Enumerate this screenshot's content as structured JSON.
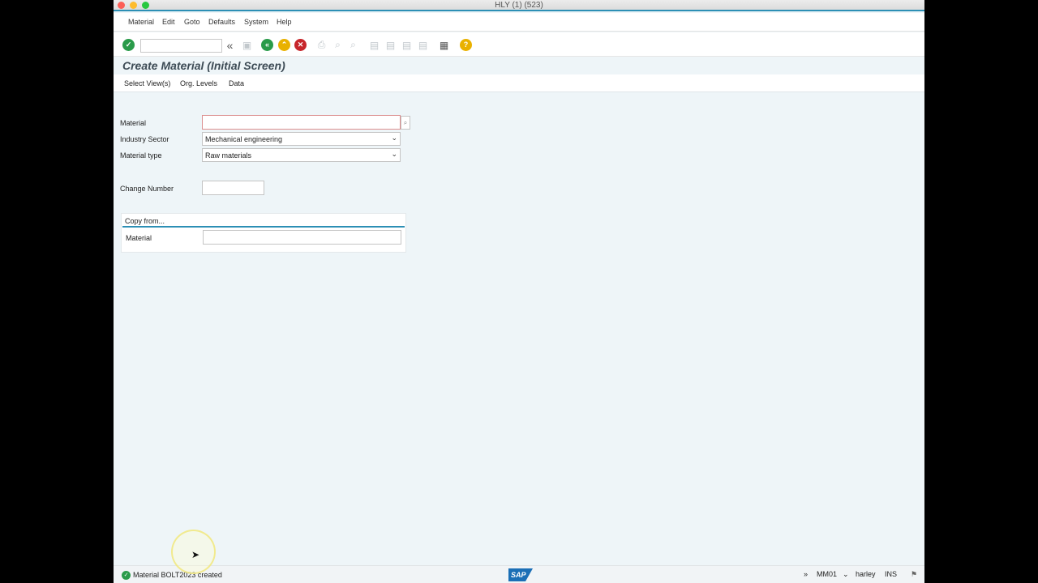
{
  "window": {
    "title": "HLY (1) (523)"
  },
  "menu": [
    "Material",
    "Edit",
    "Goto",
    "Defaults",
    "System",
    "Help"
  ],
  "toolbar": {
    "enter_icon": "check-circle-icon",
    "command_field_value": "",
    "back_icon": "chevron-double-left-icon",
    "exit_icon": "up-arrows-icon",
    "cancel_icon": "x-circle-icon",
    "help_icon": "question-icon",
    "help_symbol": "?",
    "collapse_symbol": "«"
  },
  "header": {
    "title": "Create Material (Initial Screen)"
  },
  "app_toolbar": [
    "Select View(s)",
    "Org. Levels",
    "Data"
  ],
  "form": {
    "material_label": "Material",
    "material_value": "",
    "industry_label": "Industry Sector",
    "industry_value": "Mechanical engineering",
    "type_label": "Material type",
    "type_value": "Raw materials",
    "change_label": "Change Number",
    "change_value": ""
  },
  "copy_from": {
    "title": "Copy from...",
    "material_label": "Material",
    "material_value": ""
  },
  "status": {
    "message": "Material BOLT2023 created",
    "chevron": "»",
    "transaction": "MM01",
    "user": "harley",
    "mode": "INS",
    "logo": "SAP"
  },
  "colors": {
    "accent": "#2c8fb5",
    "ok_green": "#2a9b4a",
    "cancel_red": "#c7262b",
    "exit_yellow": "#e9b100",
    "sap_blue": "#1b6fb6"
  }
}
